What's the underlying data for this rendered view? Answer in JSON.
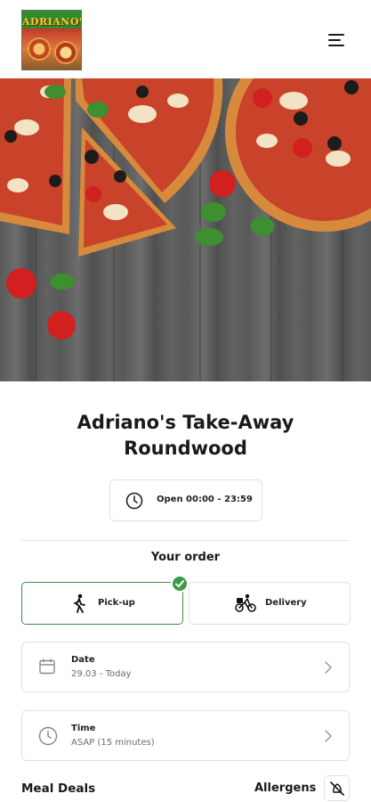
{
  "header": {
    "logo_text": "ADRIANO'S",
    "menu_icon": "hamburger-menu-icon"
  },
  "restaurant": {
    "name_line1": "Adriano's Take-Away",
    "name_line2": "Roundwood"
  },
  "hours": {
    "icon": "clock-icon",
    "label": "Open 00:00 - 23:59"
  },
  "order": {
    "heading": "Your order",
    "options": [
      {
        "label": "Pick-up",
        "icon": "walking-person-icon",
        "selected": true
      },
      {
        "label": "Delivery",
        "icon": "bicycle-courier-icon",
        "selected": false
      }
    ],
    "date": {
      "label": "Date",
      "value": "29.03 - Today",
      "icon": "calendar-icon"
    },
    "time": {
      "label": "Time",
      "value": "ASAP (15 minutes)",
      "icon": "clock-icon"
    }
  },
  "menu": {
    "category": "Meal Deals",
    "allergens_label": "Allergens",
    "allergens_icon": "allergen-no-grain-icon"
  },
  "colors": {
    "accent_green": "#3a9a48",
    "border": "#e1e1e1",
    "text": "#1a1a1a",
    "muted": "#6b6b6b"
  }
}
